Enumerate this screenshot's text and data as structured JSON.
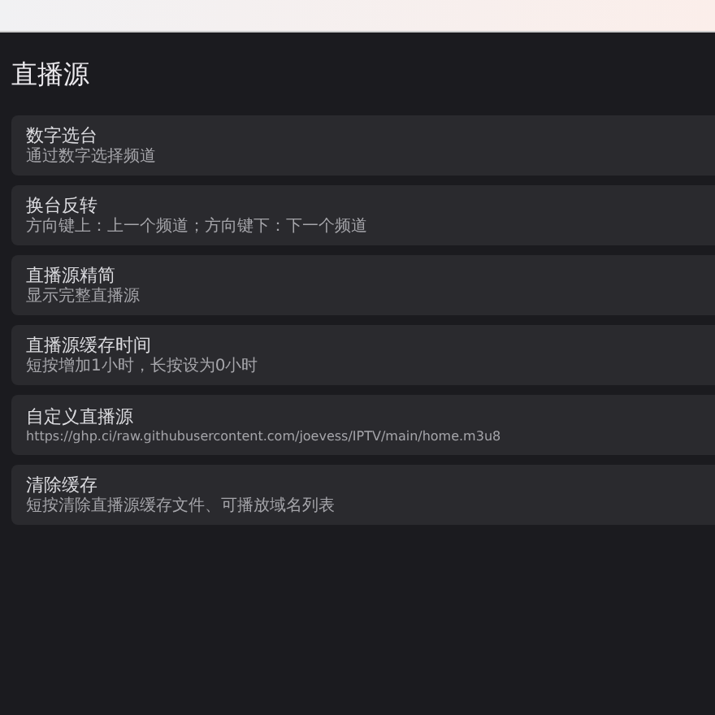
{
  "page_title": "直播源",
  "settings": [
    {
      "title": "数字选台",
      "subtitle": "通过数字选择频道"
    },
    {
      "title": "换台反转",
      "subtitle": "方向键上：上一个频道；方向键下：下一个频道"
    },
    {
      "title": "直播源精简",
      "subtitle": "显示完整直播源"
    },
    {
      "title": "直播源缓存时间",
      "subtitle": "短按增加1小时，长按设为0小时"
    },
    {
      "title": "自定义直播源",
      "subtitle": "https://ghp.ci/raw.githubusercontent.com/joevess/IPTV/main/home.m3u8"
    },
    {
      "title": "清除缓存",
      "subtitle": "短按清除直播源缓存文件、可播放域名列表"
    }
  ]
}
